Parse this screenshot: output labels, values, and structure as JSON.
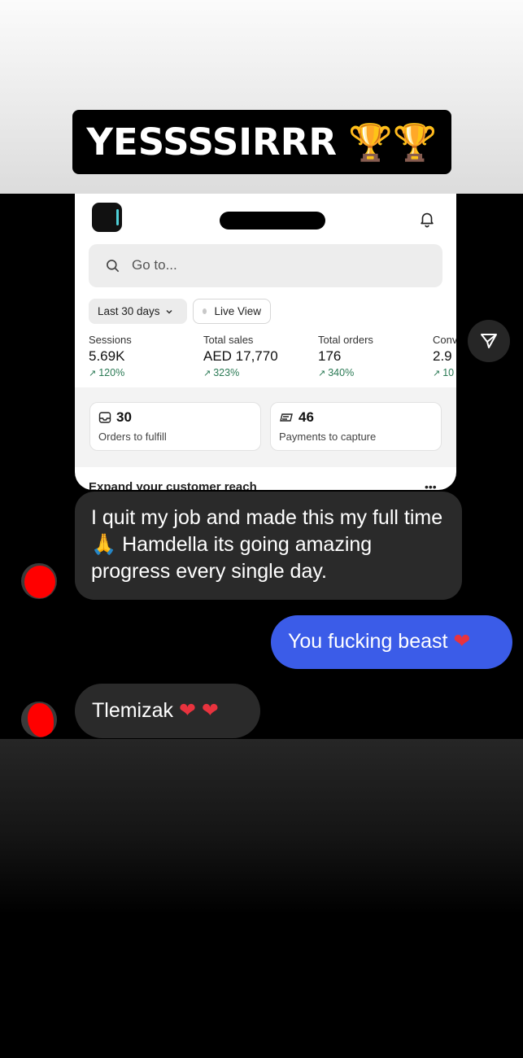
{
  "story": {
    "caption": {
      "text": "YESSSSIRRR",
      "emoji": "🏆🏆"
    }
  },
  "dashboard": {
    "search_placeholder": "Go to...",
    "range_filter": "Last 30 days",
    "live_view": "Live View",
    "metrics": [
      {
        "label": "Sessions",
        "value": "5.69K",
        "trend": "120%"
      },
      {
        "label": "Total sales",
        "value": "AED 17,770",
        "trend": "323%"
      },
      {
        "label": "Total orders",
        "value": "176",
        "trend": "340%"
      },
      {
        "label": "Conv",
        "value": "2.9",
        "trend": "10"
      }
    ],
    "tasks": [
      {
        "count": "30",
        "label": "Orders to fulfill",
        "icon": "inbox-icon"
      },
      {
        "count": "46",
        "label": "Payments to capture",
        "icon": "payment-icon"
      }
    ],
    "expand_section": "Expand your customer reach",
    "expand_more": "•••"
  },
  "chat": {
    "messages": [
      {
        "sender": "them",
        "text": "I quit my job and made this my full time",
        "emoji": "🙏",
        "text_after": "Hamdella its going amazing progress every single day."
      },
      {
        "sender": "me",
        "text": "You fucking beast",
        "emoji": "❤"
      },
      {
        "sender": "them",
        "text": "Tlemizak",
        "emoji": "❤ ❤"
      }
    ]
  },
  "colors": {
    "outgoing_bubble": "#3b5ce8",
    "incoming_bubble": "#2a2a2a",
    "trend_green": "#2b7a55",
    "redaction_red": "#ff0000"
  }
}
